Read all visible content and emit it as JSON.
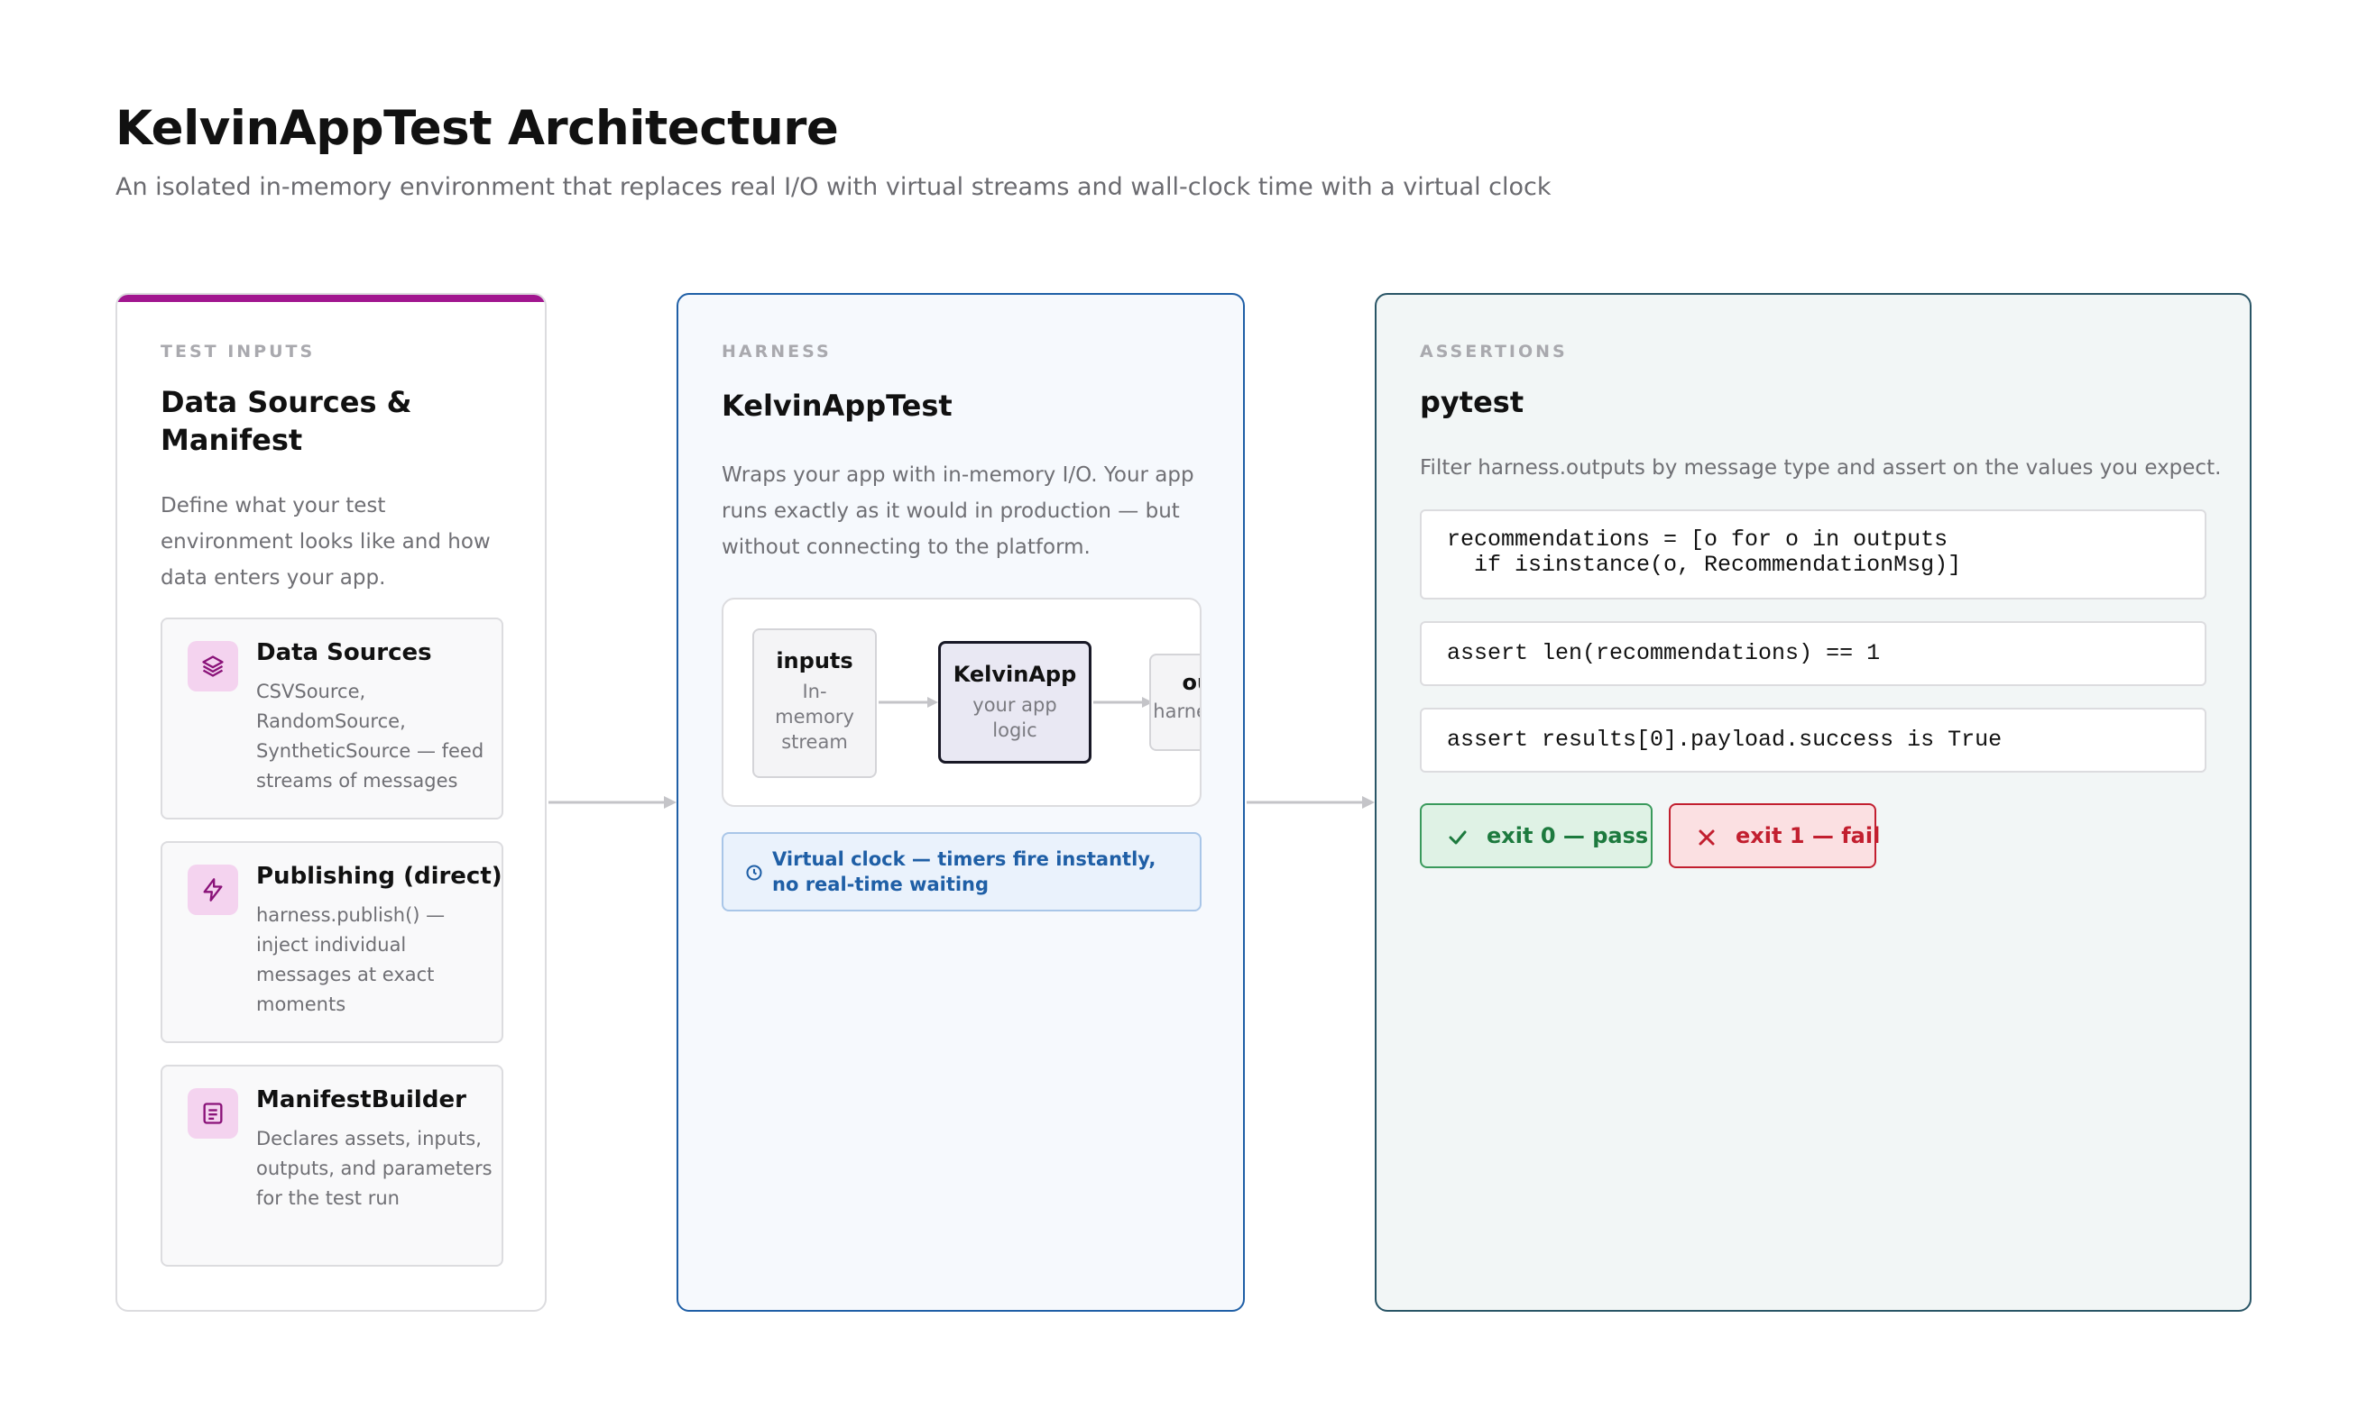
{
  "header": {
    "title": "KelvinAppTest Architecture",
    "subtitle": "An isolated in-memory environment that replaces real I/O with virtual streams and wall-clock time with a virtual clock"
  },
  "inputs_panel": {
    "kicker": "TEST INPUTS",
    "title": "Data Sources & Manifest",
    "description": "Define what your test environment looks like and how data enters your app.",
    "accent_color": "#a1168f",
    "cards": [
      {
        "icon": "layers-icon",
        "title": "Data Sources",
        "body": "CSVSource, RandomSource, SyntheticSource — feed streams of messages"
      },
      {
        "icon": "lightning-icon",
        "title": "Publishing (direct)",
        "body": "harness.publish() — inject individual messages at exact moments"
      },
      {
        "icon": "document-icon",
        "title": "ManifestBuilder",
        "body": "Declares assets, inputs, outputs, and parameters for the test run"
      }
    ]
  },
  "harness_panel": {
    "kicker": "HARNESS",
    "title": "KelvinAppTest",
    "description": "Wraps your app with in-memory I/O. Your app runs exactly as it would in production — but without connecting to the platform.",
    "border_color": "#1f5fa6",
    "flow": {
      "inputs": {
        "title": "inputs",
        "sub": "In-memory stream"
      },
      "app": {
        "title": "KelvinApp",
        "sub": "your app logic"
      },
      "outputs": {
        "title": "outputs",
        "sub": "harness.outputs"
      }
    },
    "clock_note": "Virtual clock — timers fire instantly, no real-time waiting"
  },
  "assertions_panel": {
    "kicker": "ASSERTIONS",
    "title": "pytest",
    "description": "Filter harness.outputs by message type and assert on the values you expect.",
    "border_color": "#295566",
    "code": [
      "recommendations = [o for o in outputs\n  if isinstance(o, RecommendationMsg)]",
      "assert len(recommendations) == 1",
      "assert results[0].payload.success is True"
    ],
    "pass_badge": {
      "label": "exit 0 — pass",
      "color": "#1d7a3e"
    },
    "fail_badge": {
      "label": "exit 1 — fail",
      "color": "#c21f2f"
    }
  }
}
